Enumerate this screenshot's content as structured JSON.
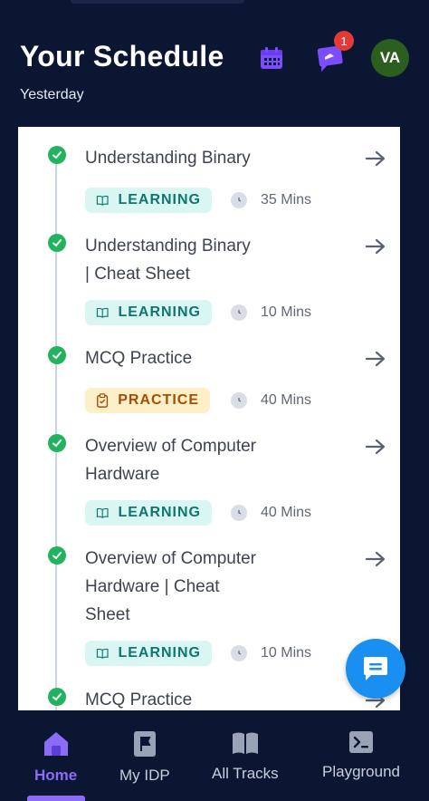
{
  "header": {
    "title": "Your Schedule",
    "subtitle": "Yesterday",
    "notification_count": "1",
    "avatar_initials": "VA"
  },
  "items": [
    {
      "title_lines": [
        "Understanding Binary"
      ],
      "tag": "LEARNING",
      "duration": "35 Mins"
    },
    {
      "title_lines": [
        "Understanding Binary",
        "| Cheat Sheet"
      ],
      "tag": "LEARNING",
      "duration": "10 Mins"
    },
    {
      "title_lines": [
        "MCQ Practice"
      ],
      "tag": "PRACTICE",
      "duration": "40 Mins"
    },
    {
      "title_lines": [
        "Overview of Computer",
        "Hardware"
      ],
      "tag": "LEARNING",
      "duration": "40 Mins"
    },
    {
      "title_lines": [
        "Overview of Computer",
        "Hardware | Cheat",
        "Sheet"
      ],
      "tag": "LEARNING",
      "duration": "10 Mins"
    },
    {
      "title_lines": [
        "MCQ Practice"
      ],
      "tag": "",
      "duration": ""
    }
  ],
  "nav": {
    "home": "Home",
    "idp": "My IDP",
    "tracks": "All Tracks",
    "playground": "Playground"
  },
  "colors": {
    "header_bg": "#0b1633",
    "accent_purple": "#8b6cf6",
    "check_green": "#22b35e",
    "learning_bg": "#d9f6f3",
    "learning_text": "#0f766e",
    "practice_bg": "#fdf0c8",
    "practice_text": "#a84c05",
    "fab_blue": "#1a8ff2"
  }
}
